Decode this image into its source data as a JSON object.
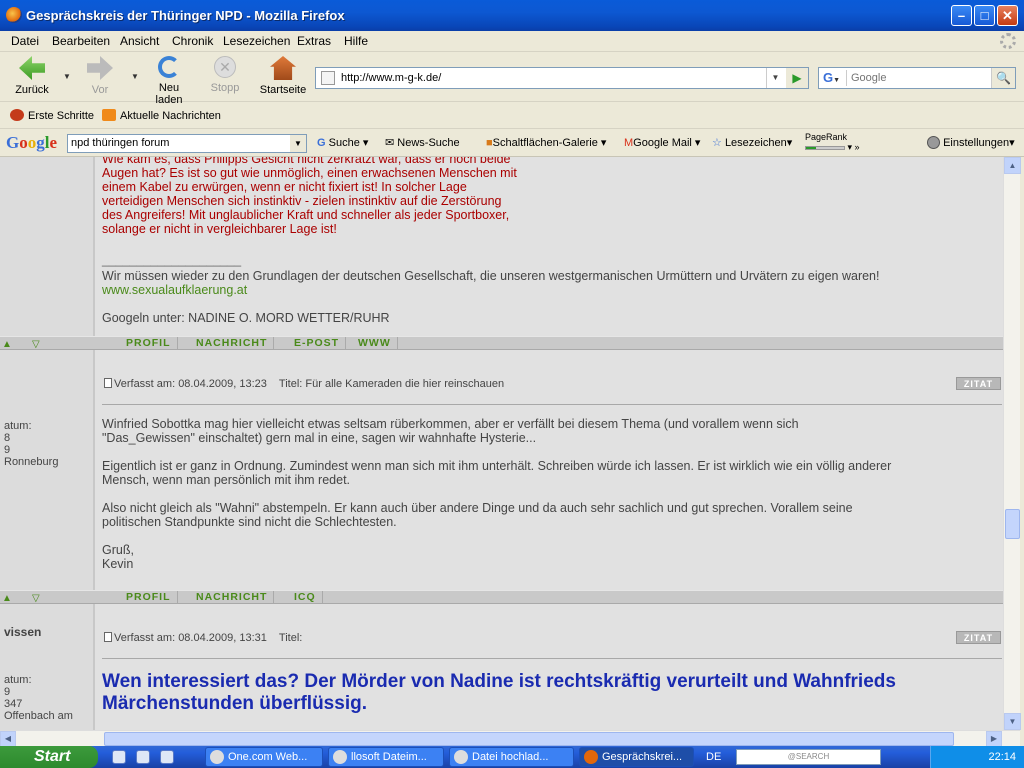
{
  "window": {
    "title": "Gesprächskreis der Thüringer NPD - Mozilla Firefox"
  },
  "menu": [
    "Datei",
    "Bearbeiten",
    "Ansicht",
    "Chronik",
    "Lesezeichen",
    "Extras",
    "Hilfe"
  ],
  "nav": {
    "back": "Zurück",
    "forward": "Vor",
    "reload": "Neu laden",
    "stop": "Stopp",
    "home": "Startseite",
    "url": "http://www.m-g-k.de/",
    "search_placeholder": "Google"
  },
  "bookmarks": [
    "Erste Schritte",
    "Aktuelle Nachrichten"
  ],
  "google_toolbar": {
    "logo": "Google",
    "query": "npd thüringen forum",
    "suche": "Suche",
    "news": "News-Suche",
    "gallery": "Schaltflächen-Galerie",
    "mail": "Google Mail",
    "lesezeichen": "Lesezeichen",
    "pagerank": "PageRank",
    "more": "»",
    "settings": "Einstellungen"
  },
  "post1": {
    "quote_lines": [
      "Wie kam es, dass Philipps Gesicht nicht zerkratzt war, dass er noch beide",
      "Augen hat? Es ist so gut wie unmöglich, einen erwachsenen Menschen mit",
      "einem Kabel zu erwürgen, wenn er nicht fixiert ist! In solcher Lage",
      "verteidigen Menschen sich instinktiv - zielen instinktiv auf die Zerstörung",
      "des Angreifers! Mit unglaublicher Kraft und schneller als jeder Sportboxer,",
      "solange er nicht in vergleichbarer Lage ist!"
    ],
    "signature_rule": "____________________",
    "signature": "Wir müssen wieder zu den Grundlagen der deutschen Gesellschaft, die unseren westgermanischen Urmüttern und Urvätern zu eigen waren!",
    "link": "www.sexualaufklaerung.at",
    "googeln": "Googeln unter: NADINE O. MORD WETTER/RUHR",
    "buttons": [
      "PROFIL",
      "NACHRICHT",
      "E-POST",
      "WWW"
    ]
  },
  "post2": {
    "meta": "Verfasst am: 08.04.2009, 13:23    Titel: Für alle Kameraden die hier reinschauen",
    "zitat": "ZITAT",
    "sidebar": [
      "atum:",
      "8",
      "9",
      "Ronneburg"
    ],
    "paragraphs": [
      "Winfried Sobottka mag hier vielleicht etwas seltsam rüberkommen, aber er verfällt bei diesem Thema (und vorallem wenn sich",
      "\"Das_Gewissen\" einschaltet) gern mal in eine, sagen wir wahnhafte Hysterie...",
      "Eigentlich ist er ganz in Ordnung. Zumindest wenn man sich mit ihm unterhält. Schreiben würde ich lassen. Er ist wirklich wie ein völlig anderer",
      "Mensch, wenn man persönlich mit ihm redet.",
      "Also nicht gleich als \"Wahni\" abstempeln. Er kann auch über andere Dinge und da auch sehr sachlich und gut sprechen. Vorallem seine",
      "politischen Standpunkte sind nicht die Schlechtesten.",
      "Gruß,",
      "Kevin"
    ],
    "buttons": [
      "PROFIL",
      "NACHRICHT",
      "ICQ"
    ]
  },
  "post3": {
    "author": "vissen",
    "meta": "Verfasst am: 08.04.2009, 13:31    Titel:",
    "zitat": "ZITAT",
    "sidebar": [
      "atum:",
      "9",
      "347",
      "Offenbach am"
    ],
    "headline": [
      "Wen interessiert das? Der Mörder von Nadine ist rechtskräftig verurteilt und Wahnfrieds",
      "Märchenstunden überflüssig."
    ]
  },
  "taskbar": {
    "start": "Start",
    "tasks": [
      "One.com Web...",
      "llosoft Dateim...",
      "Datei hochlad...",
      "Gesprächskrei..."
    ],
    "lang": "DE",
    "search": "@SEARCH",
    "clock": "22:14"
  },
  "colors": {
    "accent_green": "#4a8a1a",
    "quote_red": "#aa0000",
    "headline_blue": "#1a2bb0"
  }
}
